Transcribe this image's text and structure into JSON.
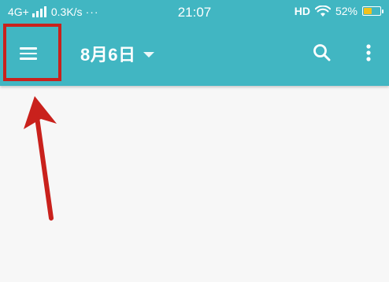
{
  "status_bar": {
    "network": "4G+",
    "speed": "0.3K/s",
    "more_dots": "···",
    "time": "21:07",
    "hd": "HD",
    "battery_percent": "52%",
    "battery_level": 0.52,
    "battery_color": "#f3c11b"
  },
  "app_bar": {
    "menu_icon": "hamburger-menu-icon",
    "title": "8月6日",
    "dropdown_icon": "caret-down-icon",
    "search_icon": "search-icon",
    "more_icon": "more-vertical-icon",
    "background_color": "#41b6c2"
  },
  "annotation": {
    "highlight_color": "#c9211c",
    "arrow_color": "#c9211c"
  }
}
